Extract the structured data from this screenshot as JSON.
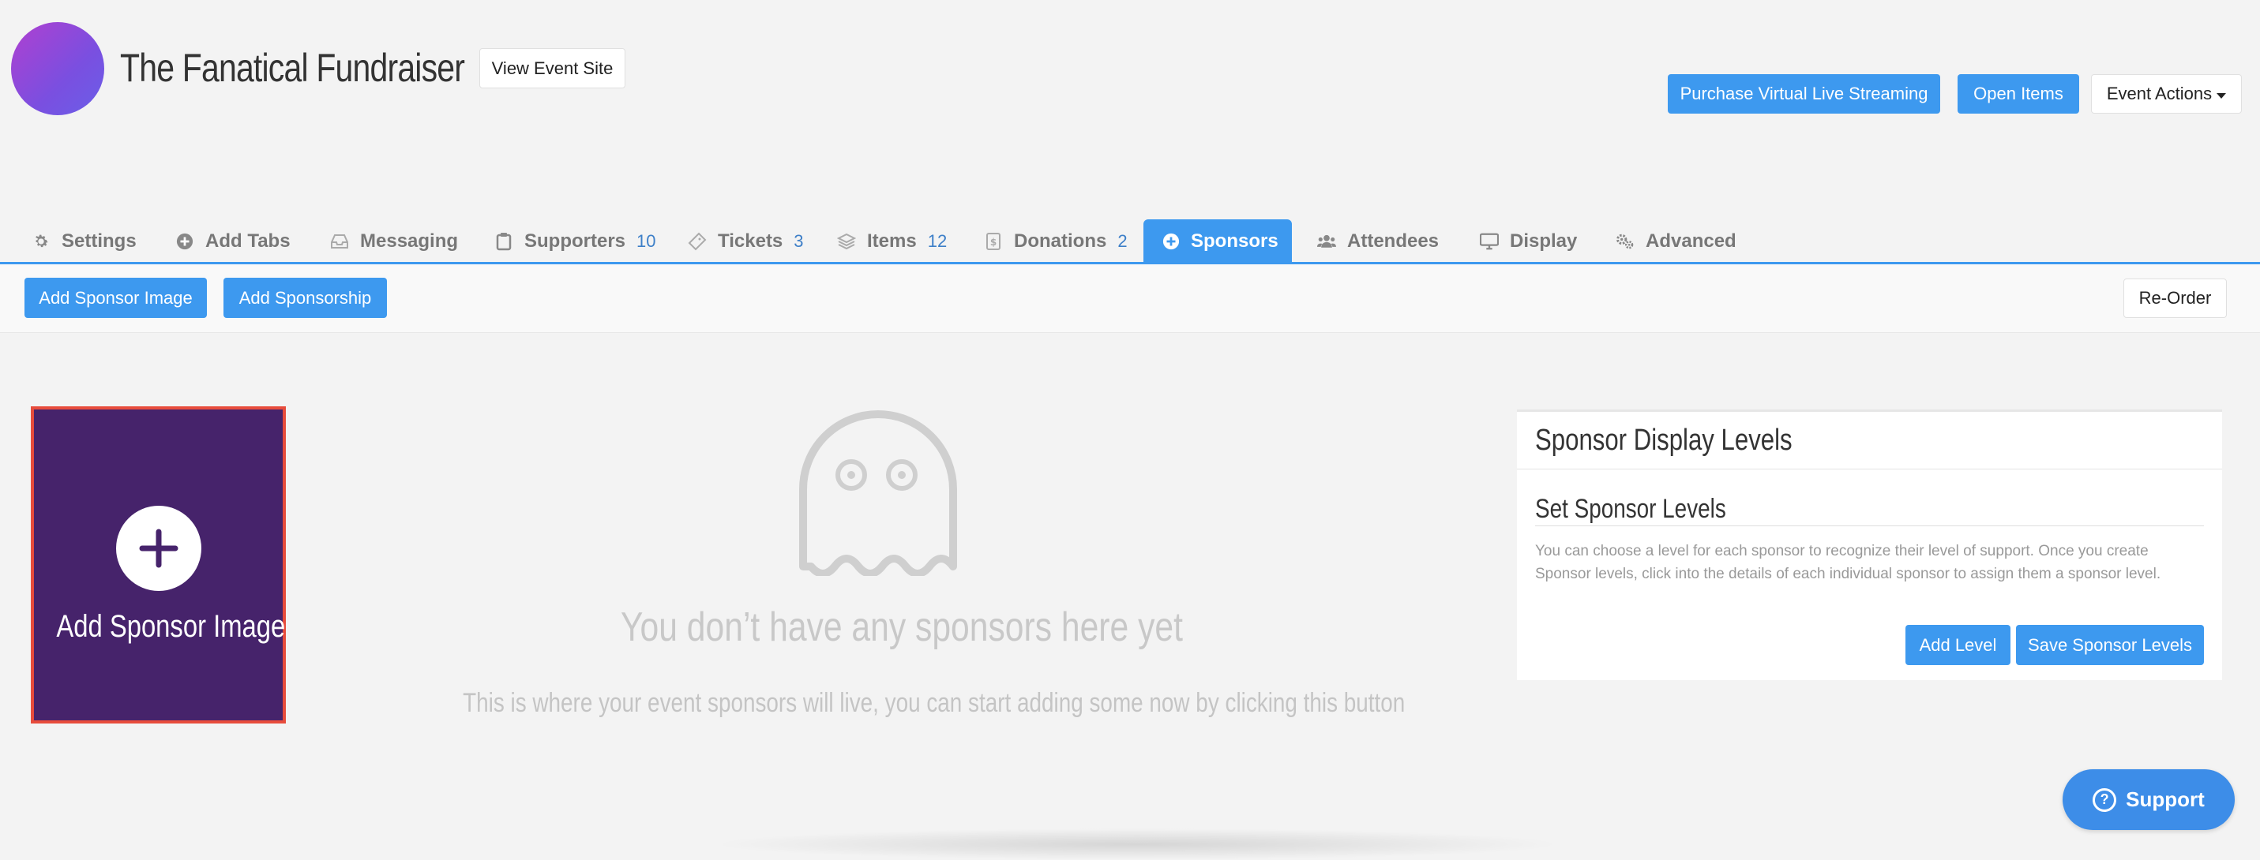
{
  "header": {
    "title": "The Fanatical Fundraiser",
    "view_event_site": "View Event Site",
    "purchase_streaming": "Purchase Virtual Live Streaming",
    "open_items": "Open Items",
    "event_actions": "Event Actions"
  },
  "tabs": [
    {
      "label": "Settings",
      "icon": "gear-icon"
    },
    {
      "label": "Add Tabs",
      "icon": "plus-circle-icon"
    },
    {
      "label": "Messaging",
      "icon": "inbox-icon"
    },
    {
      "label": "Supporters",
      "count": "10",
      "icon": "clipboard-icon"
    },
    {
      "label": "Tickets",
      "count": "3",
      "icon": "ticket-icon"
    },
    {
      "label": "Items",
      "count": "12",
      "icon": "layers-icon"
    },
    {
      "label": "Donations",
      "count": "2",
      "icon": "receipt-icon"
    },
    {
      "label": "Sponsors",
      "icon": "plus-circle-icon",
      "active": true
    },
    {
      "label": "Attendees",
      "icon": "users-icon"
    },
    {
      "label": "Display",
      "icon": "monitor-icon"
    },
    {
      "label": "Advanced",
      "icon": "gears-icon"
    }
  ],
  "toolbar": {
    "add_sponsor_image": "Add Sponsor Image",
    "add_sponsorship": "Add Sponsorship",
    "reorder": "Re-Order"
  },
  "sponsor_tile": {
    "label": "Add Sponsor Image"
  },
  "empty_state": {
    "title": "You don’t have any sponsors here yet",
    "description": "This is where your event sponsors will live, you can start adding some now by clicking this button"
  },
  "levels_panel": {
    "title": "Sponsor Display Levels",
    "subtitle": "Set Sponsor Levels",
    "description": "You can choose a level for each sponsor to recognize their level of support. Once you create Sponsor levels, click into the details of each individual sponsor to assign them a sponsor level.",
    "add_level": "Add Level",
    "save_levels": "Save Sponsor Levels"
  },
  "support": {
    "label": "Support"
  },
  "colors": {
    "accent": "#3d99ef",
    "tile_bg": "#46236b",
    "tile_border": "#e74c3c"
  }
}
